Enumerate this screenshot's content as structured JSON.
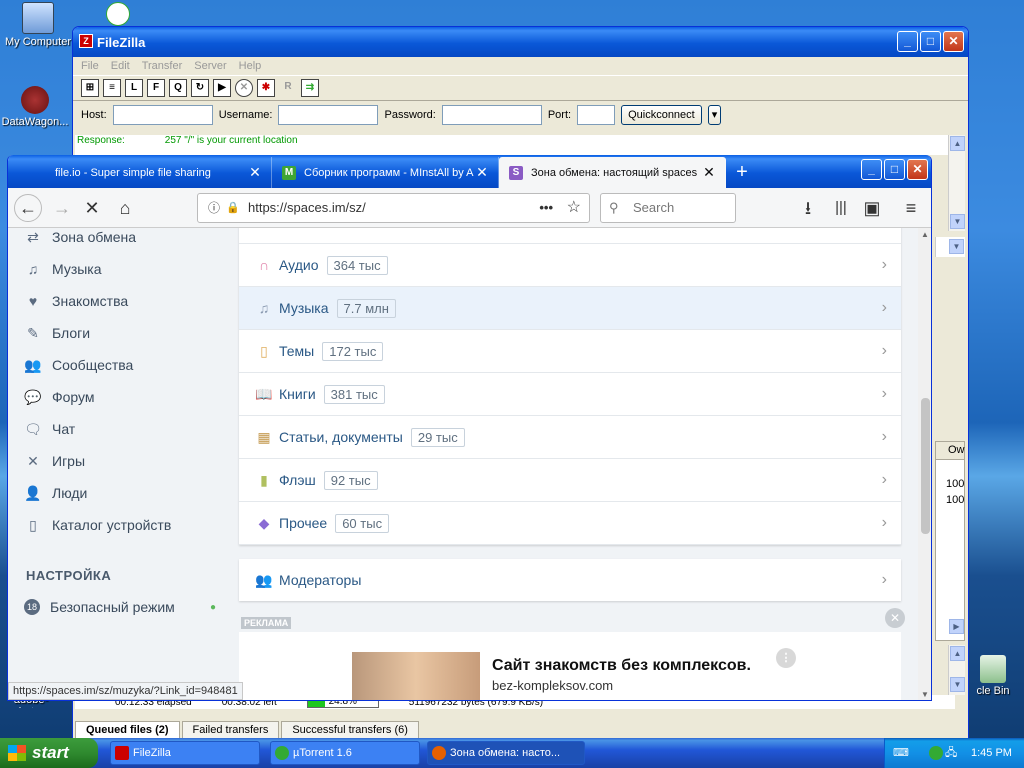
{
  "desktop": {
    "icons": [
      {
        "label": "My Computer"
      },
      {
        "label": "DataWagon..."
      },
      {
        "label": "adobe-photo..."
      },
      {
        "label": "cle Bin"
      }
    ]
  },
  "filezilla": {
    "title": "FileZilla",
    "menu": [
      "File",
      "Edit",
      "Transfer",
      "Server",
      "Help"
    ],
    "quickconnect": {
      "host_label": "Host:",
      "username_label": "Username:",
      "password_label": "Password:",
      "port_label": "Port:",
      "button": "Quickconnect"
    },
    "log": {
      "type": "Response:",
      "text": "257 \"/\" is your current location"
    },
    "right_col_header": "Ow",
    "right_values": [
      "100",
      "100"
    ],
    "transfer": {
      "elapsed": "00:12:33 elapsed",
      "left": "00:38:02 left",
      "progress": "24.8%",
      "progress_value": 24.8,
      "bytes": "511967232 bytes (679.9 KB/s)"
    },
    "tabs": [
      {
        "label": "Queued files (2)",
        "active": true
      },
      {
        "label": "Failed transfers",
        "active": false
      },
      {
        "label": "Successful transfers (6)",
        "active": false
      }
    ]
  },
  "firefox": {
    "tabs": [
      {
        "title": "file.io - Super simple file sharing",
        "active": false
      },
      {
        "title": "Сборник программ - MInstAll by A",
        "active": false
      },
      {
        "title": "Зона обмена: настоящий spaces",
        "active": true
      }
    ],
    "url": "https://spaces.im/sz/",
    "search_placeholder": "Search",
    "status_url": "https://spaces.im/sz/muzyka/?Link_id=948481"
  },
  "page": {
    "sidebar": {
      "items": [
        {
          "label": "Зона обмена",
          "icon": "exchange-icon"
        },
        {
          "label": "Музыка",
          "icon": "music-note-icon"
        },
        {
          "label": "Знакомства",
          "icon": "heart-icon"
        },
        {
          "label": "Блоги",
          "icon": "pencil-icon"
        },
        {
          "label": "Сообщества",
          "icon": "people-icon"
        },
        {
          "label": "Форум",
          "icon": "speech-icon"
        },
        {
          "label": "Чат",
          "icon": "chat-icon"
        },
        {
          "label": "Игры",
          "icon": "cross-swords-icon"
        },
        {
          "label": "Люди",
          "icon": "person-icon"
        },
        {
          "label": "Каталог устройств",
          "icon": "phone-icon"
        }
      ],
      "settings_heading": "НАСТРОЙКА",
      "safe_mode": {
        "badge": "18",
        "label": "Безопасный режим"
      }
    },
    "categories": [
      {
        "label": "Аудио",
        "count": "364 тыс",
        "icon": "headphones-icon"
      },
      {
        "label": "Музыка",
        "count": "7.7 млн",
        "icon": "music-note-icon",
        "highlight": true
      },
      {
        "label": "Темы",
        "count": "172 тыс",
        "icon": "phone-icon"
      },
      {
        "label": "Книги",
        "count": "381 тыс",
        "icon": "book-icon"
      },
      {
        "label": "Статьи, документы",
        "count": "29 тыс",
        "icon": "film-icon"
      },
      {
        "label": "Флэш",
        "count": "92 тыс",
        "icon": "file-icon"
      },
      {
        "label": "Прочее",
        "count": "60 тыс",
        "icon": "tag-icon"
      }
    ],
    "moderators": "Модераторы",
    "ad": {
      "label": "РЕКЛАМА",
      "title": "Сайт знакомств без комплексов.",
      "domain": "bez-kompleksov.com"
    }
  },
  "taskbar": {
    "start": "start",
    "buttons": [
      {
        "label": "FileZilla",
        "active": false
      },
      {
        "label": "µTorrent 1.6",
        "active": false
      },
      {
        "label": "Зона обмена: насто...",
        "active": true
      }
    ],
    "clock": "1:45 PM"
  }
}
